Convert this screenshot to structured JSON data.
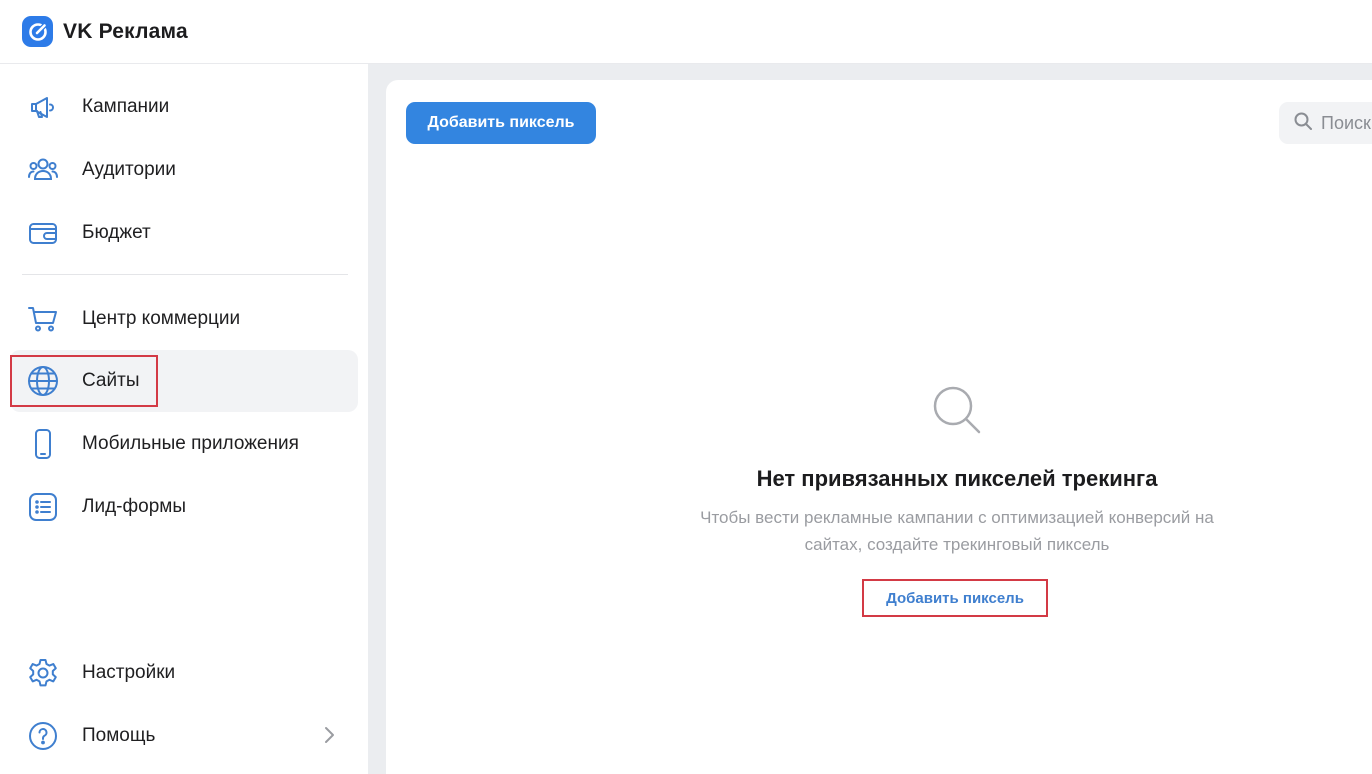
{
  "app": {
    "name": "VK Реклама",
    "accent_color": "#3385e0",
    "highlight_color": "#d33a45"
  },
  "sidebar": {
    "items": [
      {
        "label": "Кампании",
        "icon": "megaphone-icon"
      },
      {
        "label": "Аудитории",
        "icon": "users-icon"
      },
      {
        "label": "Бюджет",
        "icon": "wallet-icon"
      },
      {
        "label": "Центр коммерции",
        "icon": "cart-icon"
      },
      {
        "label": "Сайты",
        "icon": "globe-icon",
        "active": true
      },
      {
        "label": "Мобильные приложения",
        "icon": "phone-icon"
      },
      {
        "label": "Лид-формы",
        "icon": "form-icon"
      },
      {
        "label": "Настройки",
        "icon": "gear-icon"
      },
      {
        "label": "Помощь",
        "icon": "help-icon",
        "has_submenu": true
      }
    ]
  },
  "toolbar": {
    "add_pixel_label": "Добавить пиксель",
    "search_placeholder": "Поиск"
  },
  "empty_state": {
    "icon": "search-icon",
    "title": "Нет привязанных пикселей трекинга",
    "description_line1": "Чтобы вести рекламные кампании с оптимизацией конверсий на",
    "description_line2": "сайтах, создайте трекинговый пиксель",
    "action_label": "Добавить пиксель"
  }
}
